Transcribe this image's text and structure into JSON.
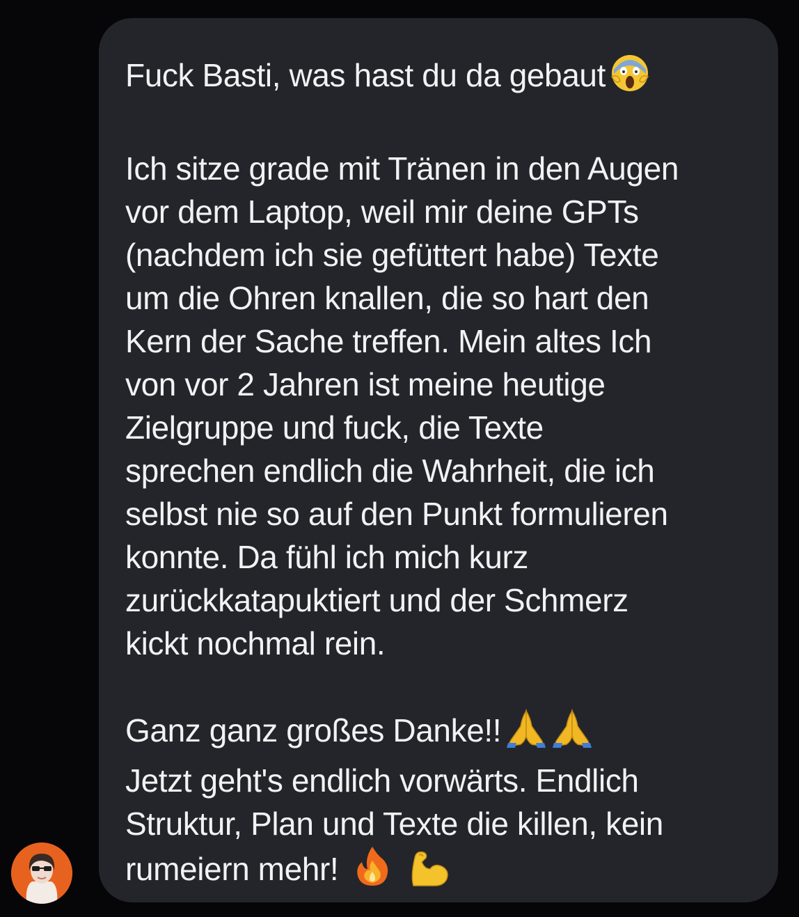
{
  "message": {
    "paragraphs": [
      {
        "text": "Fuck Basti, was hast du da gebaut",
        "emojis": [
          "face-screaming-in-fear"
        ]
      },
      {
        "text": "Ich sitze grade mit Tränen in den Augen\nvor dem Laptop, weil mir deine GPTs\n(nachdem ich sie gefüttert habe) Texte\num die Ohren knallen, die so hart den\nKern der Sache treffen. Mein altes Ich\nvon vor 2 Jahren ist meine heutige\nZielgruppe und fuck, die Texte\nsprechen endlich die Wahrheit, die ich\nselbst nie so auf den Punkt formulieren\nkonnte. Da fühl ich mich kurz\nzurückkatapuktiert und der Schmerz\nkickt nochmal rein."
      },
      {
        "text": "Ganz ganz großes Danke!!",
        "emojis": [
          "folded-hands",
          "folded-hands"
        ]
      },
      {
        "text": "Jetzt geht's endlich vorwärts. Endlich\nStruktur, Plan und Texte die killen, kein\nrumeiern mehr!",
        "emojis": [
          "fire",
          "flexed-biceps"
        ]
      }
    ],
    "bubble_color": "#24252b",
    "text_color": "#f2f2f4"
  },
  "sender": {
    "avatar_color": "#e8621f"
  },
  "background_color": "#060609"
}
